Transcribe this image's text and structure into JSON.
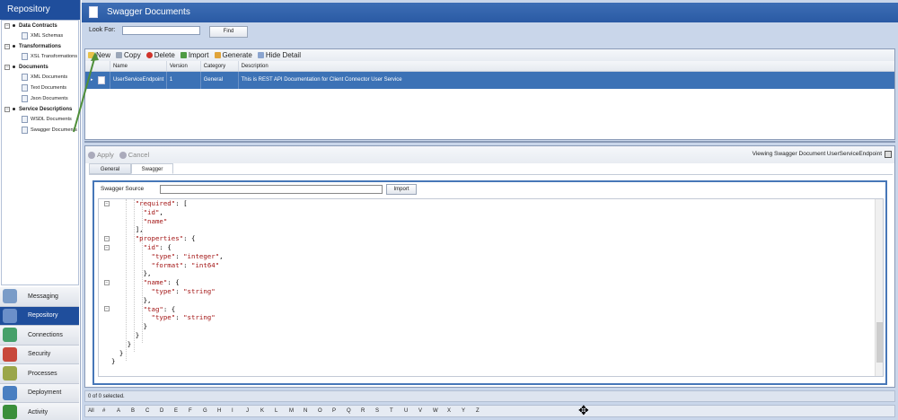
{
  "left": {
    "header": "Repository",
    "tree": [
      {
        "label": "Data Contracts",
        "children": [
          "XML Schemas"
        ]
      },
      {
        "label": "Transformations",
        "children": [
          "XSL Transformations"
        ]
      },
      {
        "label": "Documents",
        "children": [
          "XML Documents",
          "Text Documents",
          "Json Documents"
        ]
      },
      {
        "label": "Service Descriptions",
        "children": [
          "WSDL Documents",
          "Swagger Documents"
        ]
      }
    ],
    "nav": [
      {
        "label": "Messaging",
        "color": "#7a9cc8"
      },
      {
        "label": "Repository",
        "color": "#6b8fc9",
        "active": true
      },
      {
        "label": "Connections",
        "color": "#46a06a"
      },
      {
        "label": "Security",
        "color": "#c8483b"
      },
      {
        "label": "Processes",
        "color": "#9aa64a"
      },
      {
        "label": "Deployment",
        "color": "#4a7fc1"
      },
      {
        "label": "Activity",
        "color": "#3b8f3b"
      }
    ]
  },
  "main": {
    "title": "Swagger Documents",
    "look_for_label": "Look For:",
    "look_for_value": "",
    "find_label": "Find",
    "toolbar": {
      "new": "New",
      "copy": "Copy",
      "delete": "Delete",
      "import": "Import",
      "generate": "Generate",
      "hide_detail": "Hide Detail"
    },
    "grid": {
      "columns": [
        "",
        "Name",
        "Version",
        "Category",
        "Description"
      ],
      "rows": [
        {
          "name": "UserServiceEndpoint",
          "version": "1",
          "category": "General",
          "description": "This is REST API Documentation for Client Connector User Service"
        }
      ]
    },
    "detail": {
      "apply": "Apply",
      "cancel": "Cancel",
      "viewing": "Viewing Swagger Document UserServiceEndpoint",
      "tabs": [
        "General",
        "Swagger"
      ],
      "source_label": "Swagger Source",
      "source_value": "",
      "import_label": "Import",
      "code_lines": [
        "      \"required\": [",
        "        \"id\",",
        "        \"name\"",
        "      ],",
        "      \"properties\": {",
        "        \"id\": {",
        "          \"type\": \"integer\",",
        "          \"format\": \"int64\"",
        "        },",
        "        \"name\": {",
        "          \"type\": \"string\"",
        "        },",
        "        \"tag\": {",
        "          \"type\": \"string\"",
        "        }",
        "      }",
        "    }",
        "  }",
        "}"
      ]
    },
    "status": "0 of 0 selected.",
    "alphabet": [
      "All",
      "#",
      "A",
      "B",
      "C",
      "D",
      "E",
      "F",
      "G",
      "H",
      "I",
      "J",
      "K",
      "L",
      "M",
      "N",
      "O",
      "P",
      "Q",
      "R",
      "S",
      "T",
      "U",
      "V",
      "W",
      "X",
      "Y",
      "Z"
    ]
  }
}
